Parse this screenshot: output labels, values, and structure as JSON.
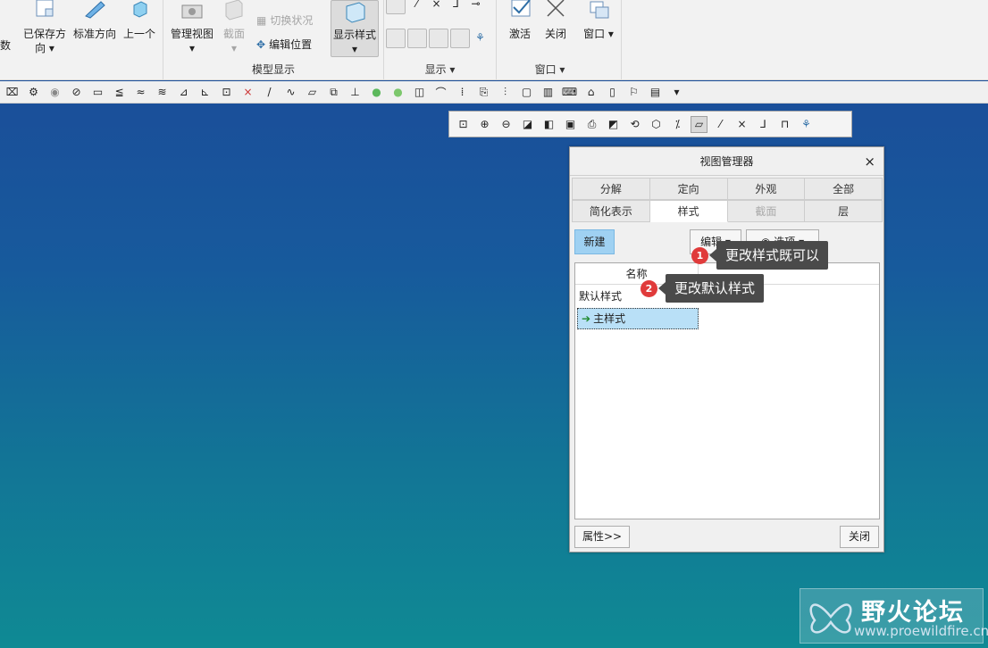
{
  "ribbon": {
    "left_cut_label": "数",
    "groups": [
      {
        "id": "orient",
        "label": ""
      },
      {
        "id": "model_display",
        "label": "模型显示"
      },
      {
        "id": "show",
        "label": "显示"
      },
      {
        "id": "window",
        "label": "窗口"
      }
    ],
    "buttons": {
      "saved_orient_l1": "已保存方",
      "saved_orient_l2": "向",
      "std_orient": "标准方向",
      "prev": "上一个",
      "manage_views": "管理视图",
      "section": "截面",
      "toggle_status": "切换状况",
      "edit_position": "编辑位置",
      "display_style": "显示样式",
      "activate": "激活",
      "close": "关闭",
      "window": "窗口"
    }
  },
  "dialog": {
    "title": "视图管理器",
    "tabs_row1": [
      "分解",
      "定向",
      "外观",
      "全部"
    ],
    "tabs_row2": [
      "简化表示",
      "样式",
      "截面",
      "层"
    ],
    "active_tab": "样式",
    "new_button": "新建",
    "edit_button": "编辑",
    "options_button": "选项",
    "list_header": "名称",
    "rows": [
      {
        "name": "默认样式",
        "selected": false
      },
      {
        "name": "主样式",
        "selected": true
      }
    ],
    "properties_button": "属性>>",
    "close_button": "关闭"
  },
  "callouts": [
    {
      "number": "1",
      "text": "更改样式既可以"
    },
    {
      "number": "2",
      "text": "更改默认样式"
    }
  ],
  "watermark": {
    "text": "野火论坛",
    "url": "www.proewildfire.cn"
  },
  "colors": {
    "background_top": "#1c4a9a",
    "background_bottom": "#0f8a94",
    "selection": "#b9e0f7",
    "new_button": "#9fd1f2",
    "badge": "#e03b3b",
    "callout": "#4a4a4a"
  }
}
